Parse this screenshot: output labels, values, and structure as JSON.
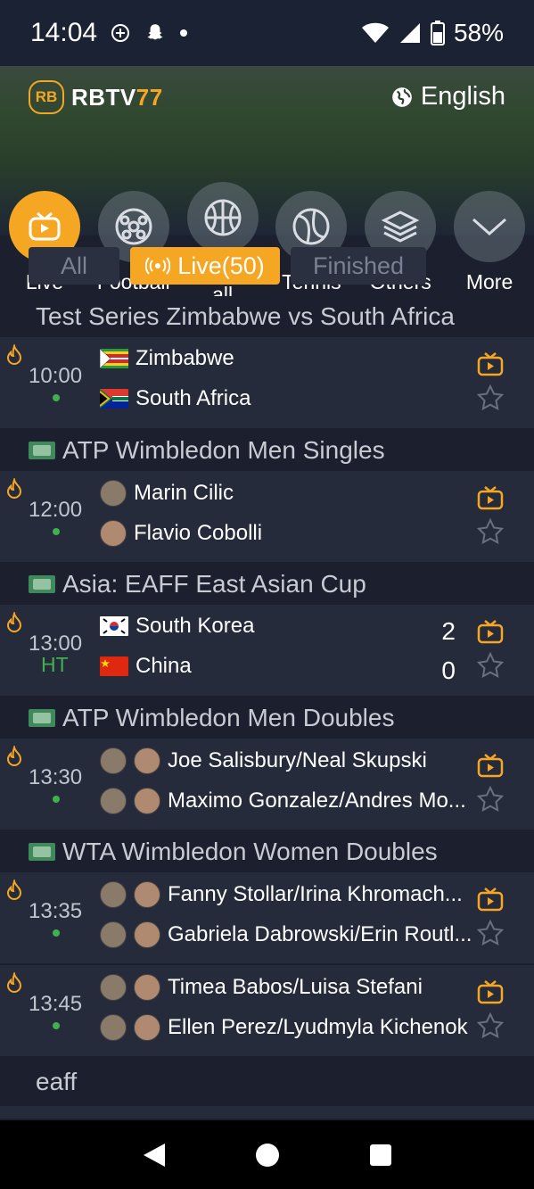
{
  "status": {
    "time": "14:04",
    "battery": "58%"
  },
  "brand": {
    "badge": "RB",
    "name": "RBTV",
    "name_num": "77"
  },
  "language": "English",
  "sports": [
    {
      "label": "Live",
      "icon": "live-tv-icon",
      "active": true
    },
    {
      "label": "Football",
      "icon": "football-icon"
    },
    {
      "label": "Basketb\nall",
      "icon": "basketball-icon"
    },
    {
      "label": "Tennis",
      "icon": "tennis-icon"
    },
    {
      "label": "Others",
      "icon": "layers-icon"
    },
    {
      "label": "More",
      "icon": "chevron-down-icon"
    }
  ],
  "filters": {
    "all": "All",
    "live": "Live(50)",
    "finished": "Finished"
  },
  "leagues": [
    {
      "name": "Test Series Zimbabwe vs South Africa"
    },
    {
      "name": "ATP Wimbledon Men Singles"
    },
    {
      "name": "Asia: EAFF East Asian Cup"
    },
    {
      "name": "ATP Wimbledon Men Doubles"
    },
    {
      "name": "WTA Wimbledon Women Doubles"
    },
    {
      "name": "eaff"
    }
  ],
  "matches": [
    {
      "time": "10:00",
      "team1": "Zimbabwe",
      "team2": "South Africa"
    },
    {
      "time": "12:00",
      "team1": "Marin Cilic",
      "team2": "Flavio Cobolli"
    },
    {
      "time": "13:00",
      "status": "HT",
      "team1": "South Korea",
      "team2": "China",
      "score1": "2",
      "score2": "0"
    },
    {
      "time": "13:30",
      "team1": "Joe Salisbury/Neal Skupski",
      "team2": "Maximo Gonzalez/Andres Mo..."
    },
    {
      "time": "13:35",
      "team1": "Fanny Stollar/Irina Khromach...",
      "team2": "Gabriela Dabrowski/Erin Routl..."
    },
    {
      "time": "13:45",
      "team1": "Timea Babos/Luisa Stefani",
      "team2": "Ellen Perez/Lyudmyla Kichenok"
    }
  ],
  "colors": {
    "accent": "#f5a623",
    "live_green": "#3fb24f",
    "background": "#1b1f2e",
    "card": "#262b3b"
  }
}
